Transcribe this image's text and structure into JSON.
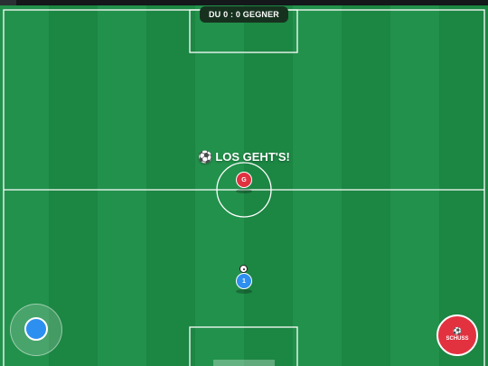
{
  "scoreboard": {
    "text": "DU 0 : 0 GEGNER"
  },
  "message": {
    "icon": "⚽",
    "text": "LOS GEHT'S!"
  },
  "players": {
    "opponent": {
      "label": "G",
      "color": "#e23240"
    },
    "player": {
      "label": "1",
      "color": "#2d8ff0"
    }
  },
  "controls": {
    "shoot_icon": "⚽",
    "shoot_label": "SCHUSS",
    "shoot_color": "#e23240",
    "joystick_color": "#2d8ff0"
  },
  "colors": {
    "pitch_light": "#22914b",
    "pitch_dark": "#1c8643",
    "lines": "#ffffff"
  }
}
